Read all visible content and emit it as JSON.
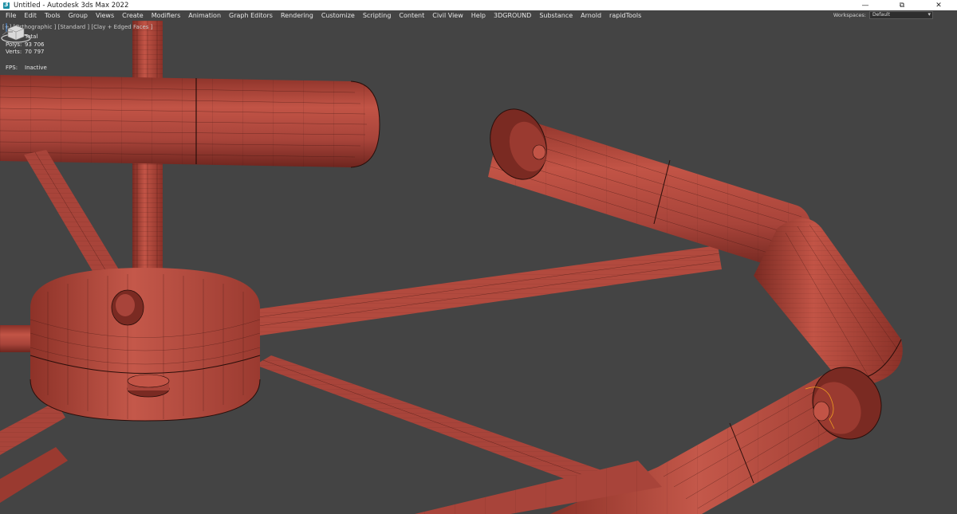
{
  "window": {
    "title": "Untitled - Autodesk 3ds Max 2022",
    "minimize": "—",
    "maximize": "⧉",
    "close": "✕"
  },
  "menu": {
    "items": [
      "File",
      "Edit",
      "Tools",
      "Group",
      "Views",
      "Create",
      "Modifiers",
      "Animation",
      "Graph Editors",
      "Rendering",
      "Customize",
      "Scripting",
      "Content",
      "Civil View",
      "Help",
      "3DGROUND",
      "Substance",
      "Arnold",
      "rapidTools"
    ],
    "workspaces_label": "Workspaces:",
    "workspaces_value": "Default"
  },
  "viewport": {
    "label": "[+] [Orthographic ] [Standard ] [Clay + Edged Faces ]",
    "stats": {
      "header": "Total",
      "polys_label": "Polys:",
      "polys_value": "93 706",
      "verts_label": "Verts:",
      "verts_value": "70 797",
      "fps_label": "FPS:",
      "fps_value": "Inactive"
    },
    "colors": {
      "background": "#444444",
      "clay": "#b24a3e",
      "clay_dark": "#7a2a22",
      "wire": "#3a1410"
    },
    "icons": [
      "viewcube-icon",
      "axis-tripod-icon"
    ]
  }
}
